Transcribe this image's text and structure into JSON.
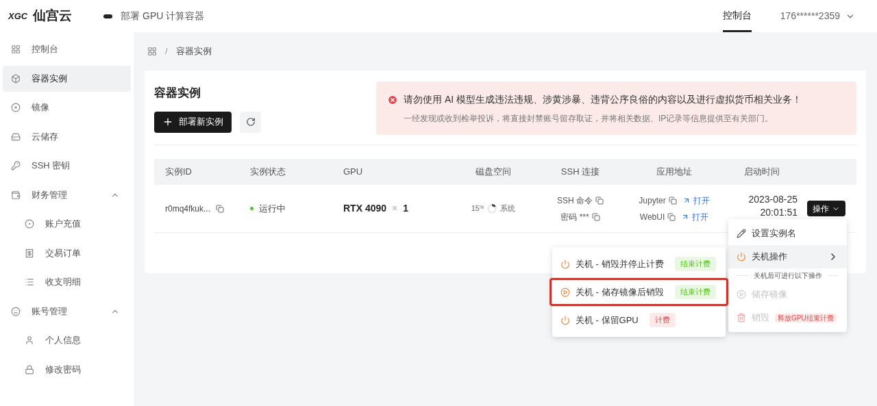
{
  "header": {
    "logo_mark": "XGC",
    "logo_text": "仙宫云",
    "page_title": "部署 GPU 计算容器",
    "nav": [
      {
        "label": "控制台",
        "selected": true
      }
    ],
    "account": "176******2359"
  },
  "sidebar": {
    "items": [
      {
        "label": "控制台",
        "selected": false
      },
      {
        "label": "容器实例",
        "selected": true
      },
      {
        "label": "镜像",
        "selected": false
      },
      {
        "label": "云储存",
        "selected": false
      },
      {
        "label": "SSH 密钥",
        "selected": false
      },
      {
        "label": "财务管理",
        "selected": false,
        "expanded": true,
        "children": [
          {
            "label": "账户充值",
            "selected": false
          },
          {
            "label": "交易订单",
            "selected": false
          },
          {
            "label": "收支明细",
            "selected": false
          }
        ]
      },
      {
        "label": "账号管理",
        "selected": false,
        "expanded": true,
        "children": [
          {
            "label": "个人信息",
            "selected": false
          },
          {
            "label": "修改密码",
            "selected": false
          }
        ]
      }
    ]
  },
  "breadcrumb": {
    "separator": "/",
    "items": [
      "容器实例"
    ]
  },
  "card": {
    "title": "容器实例",
    "deploy_button": "部署新实例",
    "alert": {
      "title": "请勿使用 AI 模型生成违法违规、涉黄涉暴、违背公序良俗的内容以及进行虚拟货币相关业务！",
      "text": "一经发现或收到检举投诉，将直接封禁账号留存取证，并将相关数据、IP记录等信息提供至有关部门。"
    }
  },
  "table": {
    "columns": [
      "实例ID",
      "实例状态",
      "GPU",
      "磁盘空间",
      "SSH 连接",
      "应用地址",
      "启动时间"
    ],
    "rows": [
      {
        "id": "r0mq4fkuk...",
        "status": "运行中",
        "gpu": "RTX 4090",
        "gpu_times": "×",
        "gpu_count": "1",
        "disk_percent": "15",
        "disk_unit": "%",
        "disk_label": "系统",
        "ssh": [
          {
            "label": "SSH 命令"
          },
          {
            "label": "密码 ***"
          }
        ],
        "apps": [
          {
            "name": "Jupyter",
            "link": "打开"
          },
          {
            "name": "WebUI",
            "link": "打开"
          }
        ],
        "start_date": "2023-08-25",
        "start_time": "20:01:51",
        "action": "操作"
      }
    ]
  },
  "action_menu": {
    "items": [
      {
        "kind": "item",
        "label": "设置实例名",
        "disabled": false,
        "selected": false
      },
      {
        "kind": "submenu",
        "label": "关机操作",
        "disabled": false,
        "selected": true
      },
      {
        "kind": "caption",
        "label": "关机后可进行以下操作"
      },
      {
        "kind": "item",
        "label": "储存镜像",
        "disabled": true,
        "selected": false
      },
      {
        "kind": "item",
        "label": "销毁",
        "disabled": true,
        "selected": false,
        "tag": "释放GPU结束计费"
      }
    ]
  },
  "shutdown_menu": {
    "items": [
      {
        "label": "关机 - 销毁并停止计费",
        "tag": "结束计费",
        "color": "#52c41a",
        "highlighted": false
      },
      {
        "label": "关机 - 储存镜像后销毁",
        "tag": "结束计费",
        "color": "#52c41a",
        "highlighted": true
      },
      {
        "label": "关机 - 保留GPU",
        "tag": "计费",
        "color": "#e5484d",
        "highlighted": false
      }
    ]
  }
}
